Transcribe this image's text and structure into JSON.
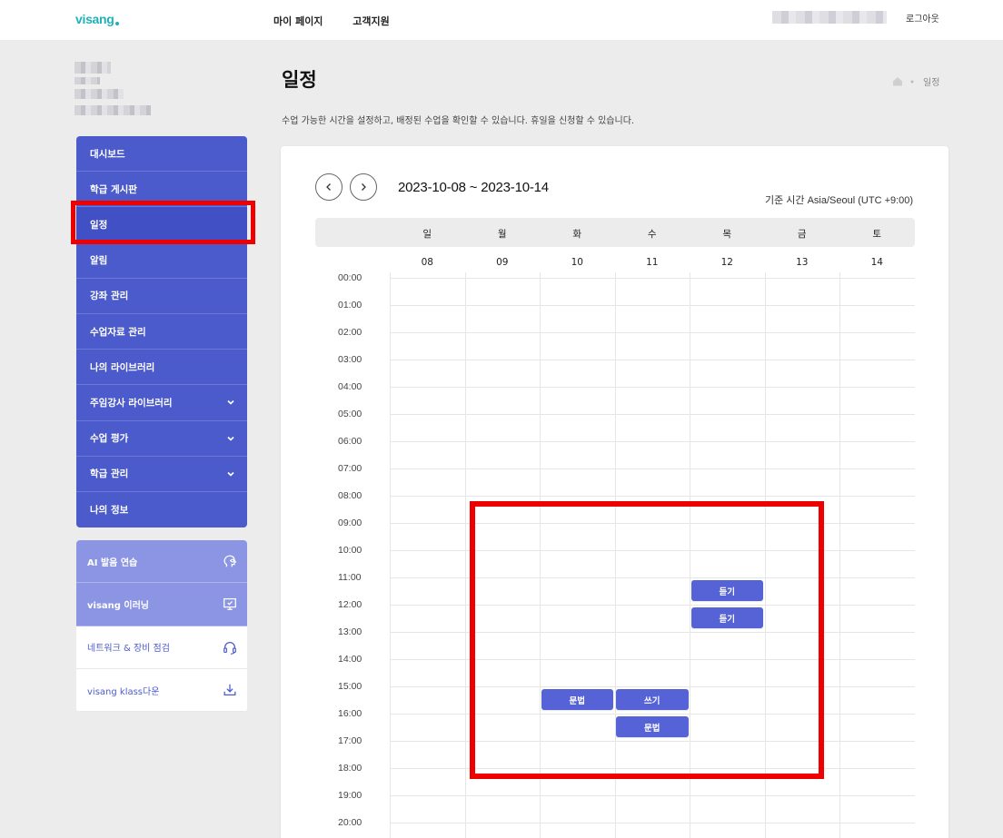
{
  "header": {
    "logo": "visang",
    "nav": [
      "마이 페이지",
      "고객지원"
    ],
    "logout": "로그아웃"
  },
  "sidebar": {
    "menu": [
      {
        "label": "대시보드",
        "chevron": false
      },
      {
        "label": "학급 게시판",
        "chevron": false
      },
      {
        "label": "일정",
        "chevron": false,
        "active": true
      },
      {
        "label": "알림",
        "chevron": false
      },
      {
        "label": "강좌 관리",
        "chevron": false
      },
      {
        "label": "수업자료 관리",
        "chevron": false
      },
      {
        "label": "나의 라이브러리",
        "chevron": false
      },
      {
        "label": "주임강사 라이브러리",
        "chevron": true
      },
      {
        "label": "수업 평가",
        "chevron": true
      },
      {
        "label": "학급 관리",
        "chevron": true
      },
      {
        "label": "나의 정보",
        "chevron": false
      }
    ],
    "quick": [
      {
        "label": "AI 발음 연습",
        "icon": "ai-head-icon"
      },
      {
        "label": "visang 이러닝",
        "icon": "monitor-check-icon"
      },
      {
        "label": "네트워크 & 장비 점검",
        "icon": "headset-icon"
      },
      {
        "label": "visang klass다운",
        "icon": "download-icon"
      }
    ]
  },
  "main": {
    "title": "일정",
    "breadcrumb": "일정",
    "description": "수업 가능한 시간을 설정하고, 배정된 수업을 확인할 수 있습니다. 휴일을 신청할 수 있습니다.",
    "date_range": "2023-10-08 ~ 2023-10-14",
    "timezone": "기준 시간 Asia/Seoul (UTC +9:00)"
  },
  "calendar": {
    "days": [
      "일",
      "월",
      "화",
      "수",
      "목",
      "금",
      "토"
    ],
    "dates": [
      "08",
      "09",
      "10",
      "11",
      "12",
      "13",
      "14"
    ],
    "times": [
      "00:00",
      "01:00",
      "02:00",
      "03:00",
      "04:00",
      "05:00",
      "06:00",
      "07:00",
      "08:00",
      "09:00",
      "10:00",
      "11:00",
      "12:00",
      "13:00",
      "14:00",
      "15:00",
      "16:00",
      "17:00",
      "18:00",
      "19:00",
      "20:00"
    ],
    "events": [
      {
        "label": "듣기",
        "day": 4,
        "hour": 11
      },
      {
        "label": "듣기",
        "day": 4,
        "hour": 12
      },
      {
        "label": "문법",
        "day": 2,
        "hour": 15
      },
      {
        "label": "쓰기",
        "day": 3,
        "hour": 15
      },
      {
        "label": "문법",
        "day": 3,
        "hour": 16
      }
    ]
  },
  "colors": {
    "primary": "#4c5bcc",
    "event": "#5563d6",
    "highlight": "#ee0000",
    "logo": "#1fb1b8"
  }
}
